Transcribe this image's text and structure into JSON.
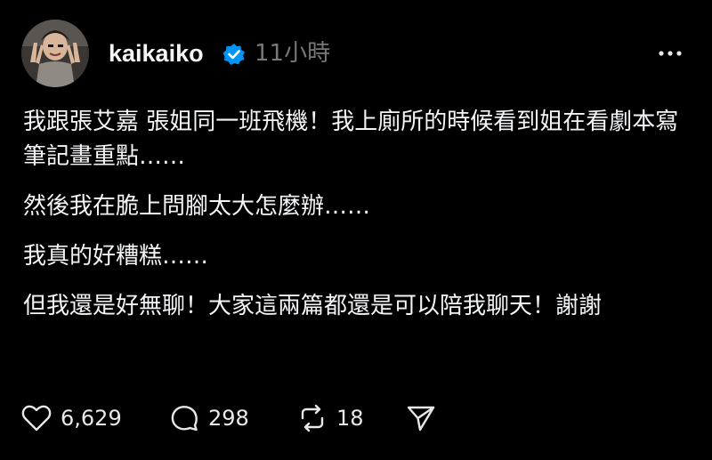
{
  "post": {
    "username": "kaikaiko",
    "timestamp": "11小時",
    "paragraphs": [
      "我跟張艾嘉 張姐同一班飛機！我上廁所的時候看到姐在看劇本寫筆記畫重點……",
      "然後我在脆上問腳太大怎麼辦……",
      "我真的好糟糕……",
      "但我還是好無聊！大家這兩篇都還是可以陪我聊天！謝謝"
    ]
  },
  "actions": {
    "likes": "6,629",
    "replies": "298",
    "reposts": "18"
  },
  "icons": {
    "verified": "verified-badge-icon",
    "more": "more-horizontal-icon",
    "like": "heart-icon",
    "reply": "comment-icon",
    "repost": "repost-icon",
    "share": "send-icon"
  },
  "colors": {
    "background": "#000000",
    "text": "#f3f5f7",
    "muted": "#777777",
    "verified": "#0095f6"
  }
}
